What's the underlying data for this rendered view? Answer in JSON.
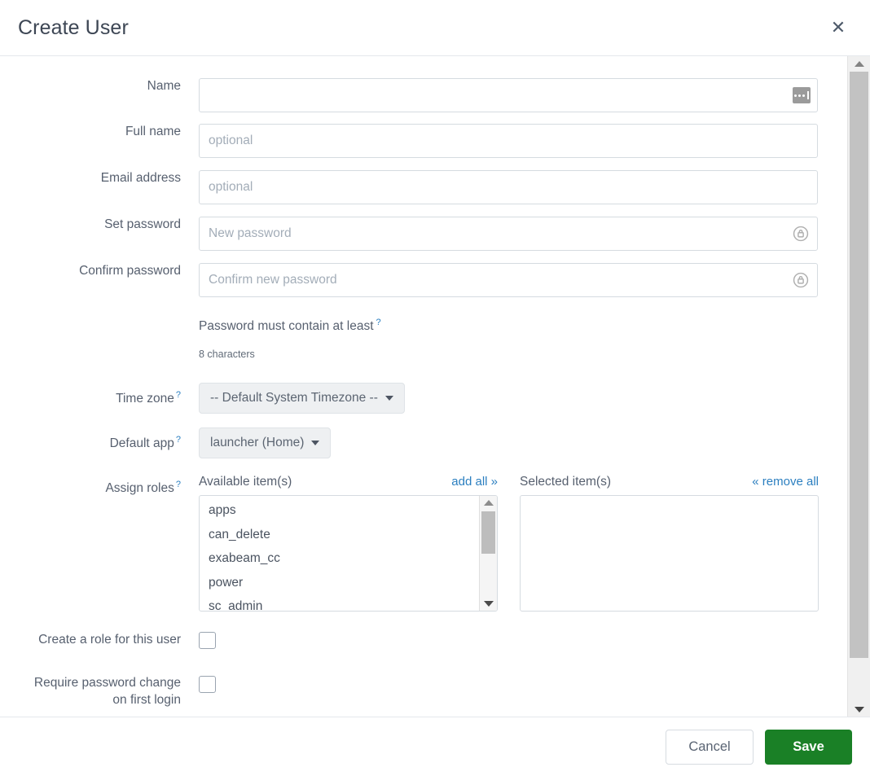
{
  "dialog": {
    "title": "Create User",
    "close_icon": "close-icon"
  },
  "form": {
    "name": {
      "label": "Name",
      "value": "",
      "placeholder": "",
      "button_icon": "ellipsis-icon"
    },
    "full_name": {
      "label": "Full name",
      "value": "",
      "placeholder": "optional"
    },
    "email": {
      "label": "Email address",
      "value": "",
      "placeholder": "optional"
    },
    "set_password": {
      "label": "Set password",
      "value": "",
      "placeholder": "New password",
      "button_icon": "password-generate-lock-icon"
    },
    "confirm_password": {
      "label": "Confirm password",
      "value": "",
      "placeholder": "Confirm new password",
      "button_icon": "password-generate-lock-icon"
    },
    "password_policy": {
      "heading": "Password must contain at least",
      "help_marker": "?",
      "rules": [
        "8 characters"
      ]
    },
    "time_zone": {
      "label": "Time zone",
      "help_marker": "?",
      "selected": "-- Default System Timezone --"
    },
    "default_app": {
      "label": "Default app",
      "help_marker": "?",
      "selected": "launcher (Home)"
    },
    "assign_roles": {
      "label": "Assign roles",
      "help_marker": "?",
      "available": {
        "caption": "Available item(s)",
        "action": "add all »",
        "items": [
          "apps",
          "can_delete",
          "exabeam_cc",
          "power",
          "sc_admin"
        ]
      },
      "selected": {
        "caption": "Selected item(s)",
        "action": "« remove all",
        "items": []
      }
    },
    "create_role": {
      "label": "Create a role for this user",
      "checked": false
    },
    "require_password_change": {
      "label_line1": "Require password change",
      "label_line2": "on first login",
      "checked": false
    }
  },
  "footer": {
    "cancel_label": "Cancel",
    "save_label": "Save"
  },
  "colors": {
    "accent_link": "#2b7fc0",
    "save_green": "#1a8026",
    "text": "#57606f",
    "border": "#d5dbe0"
  }
}
